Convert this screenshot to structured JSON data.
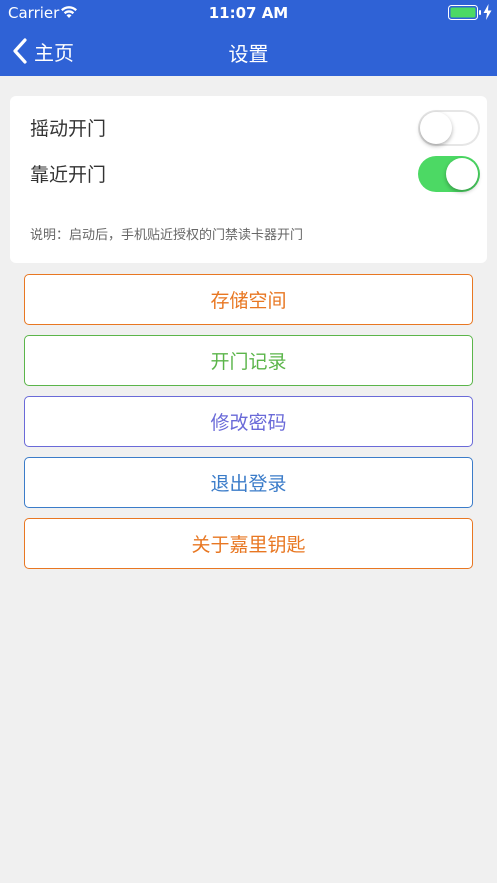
{
  "status_bar": {
    "carrier": "Carrier",
    "time": "11:07 AM",
    "battery_color": "#4cd964"
  },
  "nav": {
    "back_label": "主页",
    "title": "设置",
    "background": "#2f62d6"
  },
  "settings": {
    "rows": [
      {
        "label": "摇动开门",
        "toggle_on": false
      },
      {
        "label": "靠近开门",
        "toggle_on": true
      }
    ],
    "note": "说明：启动后，手机贴近授权的门禁读卡器开门",
    "toggle_on_color": "#4cd964"
  },
  "buttons": [
    {
      "label": "存储空间",
      "color": "#e87722"
    },
    {
      "label": "开门记录",
      "color": "#5bb54a"
    },
    {
      "label": "修改密码",
      "color": "#6a6ad8"
    },
    {
      "label": "退出登录",
      "color": "#3b7cc9"
    },
    {
      "label": "关于嘉里钥匙",
      "color": "#e87722"
    }
  ]
}
